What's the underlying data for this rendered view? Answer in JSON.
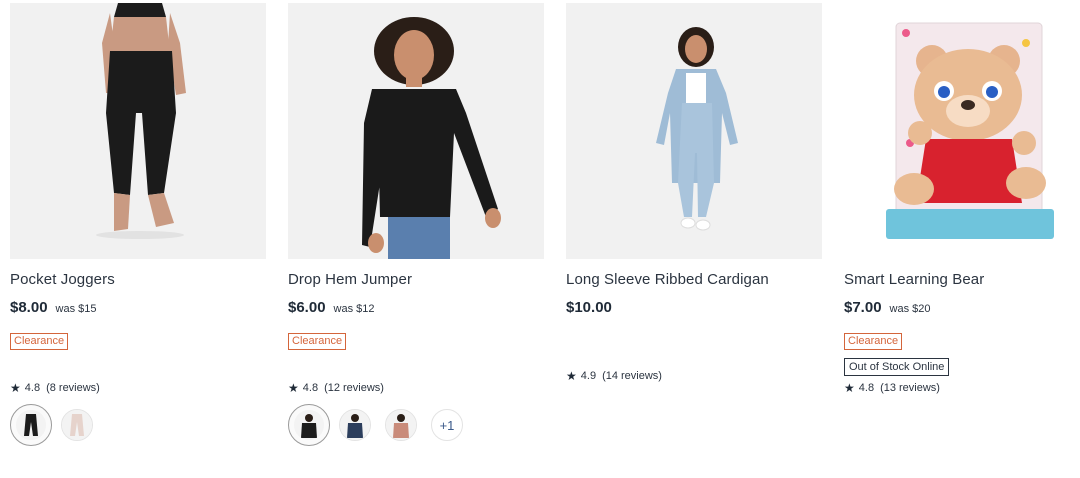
{
  "products": [
    {
      "title": "Pocket Joggers",
      "price": "$8.00",
      "was": "was $15",
      "badge": "Clearance",
      "rating": "4.8",
      "reviews": "(8 reviews)",
      "swatch_colors": [
        "#1c1c1c",
        "#e6d3cc"
      ],
      "image_icon": "model-in-black-joggers-photo"
    },
    {
      "title": "Drop Hem Jumper",
      "price": "$6.00",
      "was": "was $12",
      "badge": "Clearance",
      "rating": "4.8",
      "reviews": "(12 reviews)",
      "swatch_colors": [
        "#1c1c1c",
        "#2c3e5c",
        "#c98b7a"
      ],
      "more_colors": "+1",
      "image_icon": "model-in-black-jumper-photo"
    },
    {
      "title": "Long Sleeve Ribbed Cardigan",
      "price": "$10.00",
      "rating": "4.9",
      "reviews": "(14 reviews)",
      "image_icon": "model-in-blue-cardigan-photo"
    },
    {
      "title": "Smart Learning Bear",
      "price": "$7.00",
      "was": "was $20",
      "badge": "Clearance",
      "stock_badge": "Out of Stock Online",
      "rating": "4.8",
      "reviews": "(13 reviews)",
      "image_icon": "teddy-bear-toy-box-photo"
    }
  ],
  "colors": {
    "clearance": "#d4653b",
    "text": "#2b3440"
  }
}
